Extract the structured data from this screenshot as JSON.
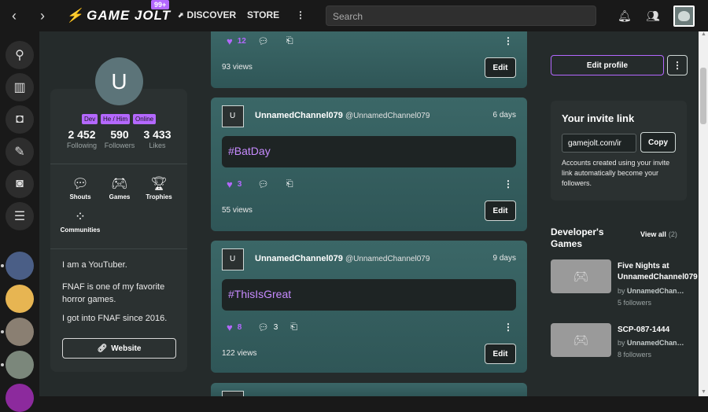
{
  "topbar": {
    "logo_text": "GAME JOLT",
    "logo_badge": "99+",
    "discover": "DISCOVER",
    "store": "STORE",
    "more": "⋮",
    "search_placeholder": "Search"
  },
  "profile": {
    "avatar_letter": "U",
    "tags": [
      "Dev",
      "He / Him",
      "Online"
    ],
    "following_count": "2 452",
    "following_label": "Following",
    "followers_count": "590",
    "followers_label": "Followers",
    "likes_count": "3 433",
    "likes_label": "Likes",
    "nav": {
      "shouts": "Shouts",
      "games": "Games",
      "trophies": "Trophies",
      "communities": "Communities"
    },
    "bio": [
      "I am a YouTuber.",
      "FNAF is one of my favorite horror games.",
      "I got into FNAF since 2016."
    ],
    "website_label": "Website"
  },
  "posts": [
    {
      "likes": "12",
      "comments": "",
      "views": "93 views",
      "edit": "Edit"
    },
    {
      "author": "UnnamedChannel079",
      "handle": "@UnnamedChannel079",
      "time": "6 days",
      "hashtag": "#BatDay",
      "likes": "3",
      "comments": "",
      "views": "55 views",
      "edit": "Edit"
    },
    {
      "author": "UnnamedChannel079",
      "handle": "@UnnamedChannel079",
      "time": "9 days",
      "hashtag": "#ThisIsGreat",
      "likes": "8",
      "comments": "3",
      "views": "122 views",
      "edit": "Edit"
    }
  ],
  "sidebar": {
    "edit_profile": "Edit profile",
    "invite_title": "Your invite link",
    "invite_value": "gamejolt.com/ir",
    "copy": "Copy",
    "invite_desc": "Accounts created using your invite link automatically become your followers.",
    "dev_games_title": "Developer's Games",
    "view_all": "View all",
    "view_all_count": "(2)",
    "games": [
      {
        "title": "Five Nights at UnnamedChannel079",
        "by_prefix": "by",
        "by": "UnnamedChan…",
        "followers": "5 followers"
      },
      {
        "title": "SCP-087-1444",
        "by_prefix": "by",
        "by": "UnnamedChan…",
        "followers": "8 followers"
      }
    ]
  },
  "colors": {
    "accent": "#b468ff",
    "post_bg": "#3b6767",
    "page_bg": "#252b2b"
  }
}
